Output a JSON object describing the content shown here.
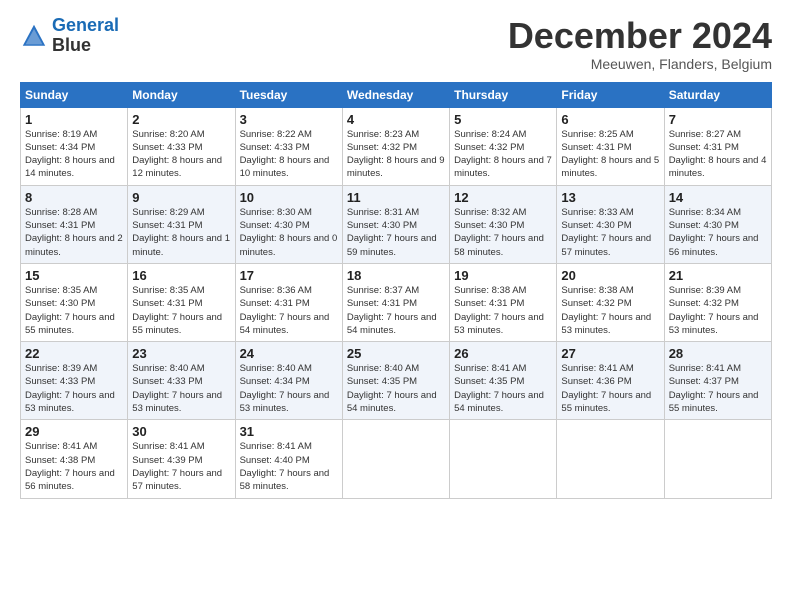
{
  "header": {
    "logo_line1": "General",
    "logo_line2": "Blue",
    "month_title": "December 2024",
    "location": "Meeuwen, Flanders, Belgium"
  },
  "weekdays": [
    "Sunday",
    "Monday",
    "Tuesday",
    "Wednesday",
    "Thursday",
    "Friday",
    "Saturday"
  ],
  "weeks": [
    [
      {
        "day": "1",
        "rise": "8:19 AM",
        "set": "4:34 PM",
        "daylight": "8 hours and 14 minutes."
      },
      {
        "day": "2",
        "rise": "8:20 AM",
        "set": "4:33 PM",
        "daylight": "8 hours and 12 minutes."
      },
      {
        "day": "3",
        "rise": "8:22 AM",
        "set": "4:33 PM",
        "daylight": "8 hours and 10 minutes."
      },
      {
        "day": "4",
        "rise": "8:23 AM",
        "set": "4:32 PM",
        "daylight": "8 hours and 9 minutes."
      },
      {
        "day": "5",
        "rise": "8:24 AM",
        "set": "4:32 PM",
        "daylight": "8 hours and 7 minutes."
      },
      {
        "day": "6",
        "rise": "8:25 AM",
        "set": "4:31 PM",
        "daylight": "8 hours and 5 minutes."
      },
      {
        "day": "7",
        "rise": "8:27 AM",
        "set": "4:31 PM",
        "daylight": "8 hours and 4 minutes."
      }
    ],
    [
      {
        "day": "8",
        "rise": "8:28 AM",
        "set": "4:31 PM",
        "daylight": "8 hours and 2 minutes."
      },
      {
        "day": "9",
        "rise": "8:29 AM",
        "set": "4:31 PM",
        "daylight": "8 hours and 1 minute."
      },
      {
        "day": "10",
        "rise": "8:30 AM",
        "set": "4:30 PM",
        "daylight": "8 hours and 0 minutes."
      },
      {
        "day": "11",
        "rise": "8:31 AM",
        "set": "4:30 PM",
        "daylight": "7 hours and 59 minutes."
      },
      {
        "day": "12",
        "rise": "8:32 AM",
        "set": "4:30 PM",
        "daylight": "7 hours and 58 minutes."
      },
      {
        "day": "13",
        "rise": "8:33 AM",
        "set": "4:30 PM",
        "daylight": "7 hours and 57 minutes."
      },
      {
        "day": "14",
        "rise": "8:34 AM",
        "set": "4:30 PM",
        "daylight": "7 hours and 56 minutes."
      }
    ],
    [
      {
        "day": "15",
        "rise": "8:35 AM",
        "set": "4:30 PM",
        "daylight": "7 hours and 55 minutes."
      },
      {
        "day": "16",
        "rise": "8:35 AM",
        "set": "4:31 PM",
        "daylight": "7 hours and 55 minutes."
      },
      {
        "day": "17",
        "rise": "8:36 AM",
        "set": "4:31 PM",
        "daylight": "7 hours and 54 minutes."
      },
      {
        "day": "18",
        "rise": "8:37 AM",
        "set": "4:31 PM",
        "daylight": "7 hours and 54 minutes."
      },
      {
        "day": "19",
        "rise": "8:38 AM",
        "set": "4:31 PM",
        "daylight": "7 hours and 53 minutes."
      },
      {
        "day": "20",
        "rise": "8:38 AM",
        "set": "4:32 PM",
        "daylight": "7 hours and 53 minutes."
      },
      {
        "day": "21",
        "rise": "8:39 AM",
        "set": "4:32 PM",
        "daylight": "7 hours and 53 minutes."
      }
    ],
    [
      {
        "day": "22",
        "rise": "8:39 AM",
        "set": "4:33 PM",
        "daylight": "7 hours and 53 minutes."
      },
      {
        "day": "23",
        "rise": "8:40 AM",
        "set": "4:33 PM",
        "daylight": "7 hours and 53 minutes."
      },
      {
        "day": "24",
        "rise": "8:40 AM",
        "set": "4:34 PM",
        "daylight": "7 hours and 53 minutes."
      },
      {
        "day": "25",
        "rise": "8:40 AM",
        "set": "4:35 PM",
        "daylight": "7 hours and 54 minutes."
      },
      {
        "day": "26",
        "rise": "8:41 AM",
        "set": "4:35 PM",
        "daylight": "7 hours and 54 minutes."
      },
      {
        "day": "27",
        "rise": "8:41 AM",
        "set": "4:36 PM",
        "daylight": "7 hours and 55 minutes."
      },
      {
        "day": "28",
        "rise": "8:41 AM",
        "set": "4:37 PM",
        "daylight": "7 hours and 55 minutes."
      }
    ],
    [
      {
        "day": "29",
        "rise": "8:41 AM",
        "set": "4:38 PM",
        "daylight": "7 hours and 56 minutes."
      },
      {
        "day": "30",
        "rise": "8:41 AM",
        "set": "4:39 PM",
        "daylight": "7 hours and 57 minutes."
      },
      {
        "day": "31",
        "rise": "8:41 AM",
        "set": "4:40 PM",
        "daylight": "7 hours and 58 minutes."
      },
      null,
      null,
      null,
      null
    ]
  ]
}
